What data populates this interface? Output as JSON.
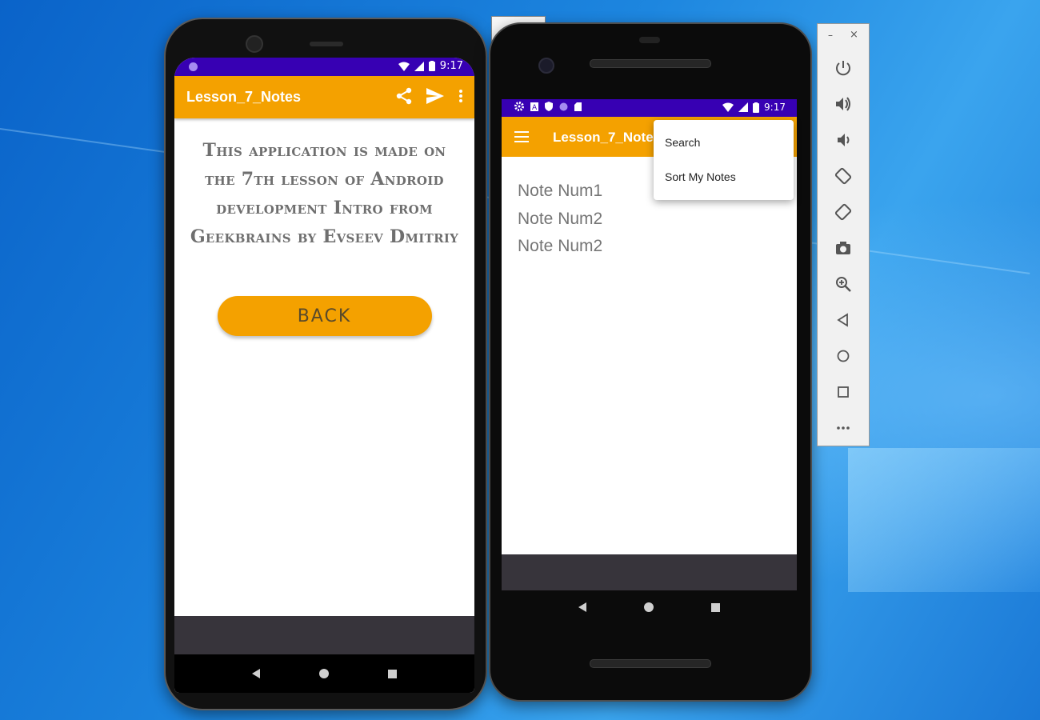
{
  "phone1": {
    "status_time": "9:17",
    "app_title": "Lesson_7_Notes",
    "about_text": "This application is made on the 7th lesson of Android development Intro from Geekbrains by Evseev Dmitriy",
    "back_button": "BACK"
  },
  "phone2": {
    "status_time": "9:17",
    "app_title": "Lesson_7_Notes",
    "menu": [
      "Search",
      "Sort My Notes"
    ],
    "notes": [
      "Note Num1",
      "Note Num2",
      "Note Num2"
    ]
  },
  "emulator_panel": {
    "minimize": "–",
    "close": "×",
    "buttons": [
      "power-icon",
      "volume-up-icon",
      "volume-down-icon",
      "rotate-left-icon",
      "rotate-right-icon",
      "camera-icon",
      "zoom-icon",
      "back-icon",
      "home-icon",
      "overview-icon",
      "more-icon"
    ]
  },
  "colors": {
    "accent": "#f4a100",
    "status_bar": "#3700b3"
  }
}
